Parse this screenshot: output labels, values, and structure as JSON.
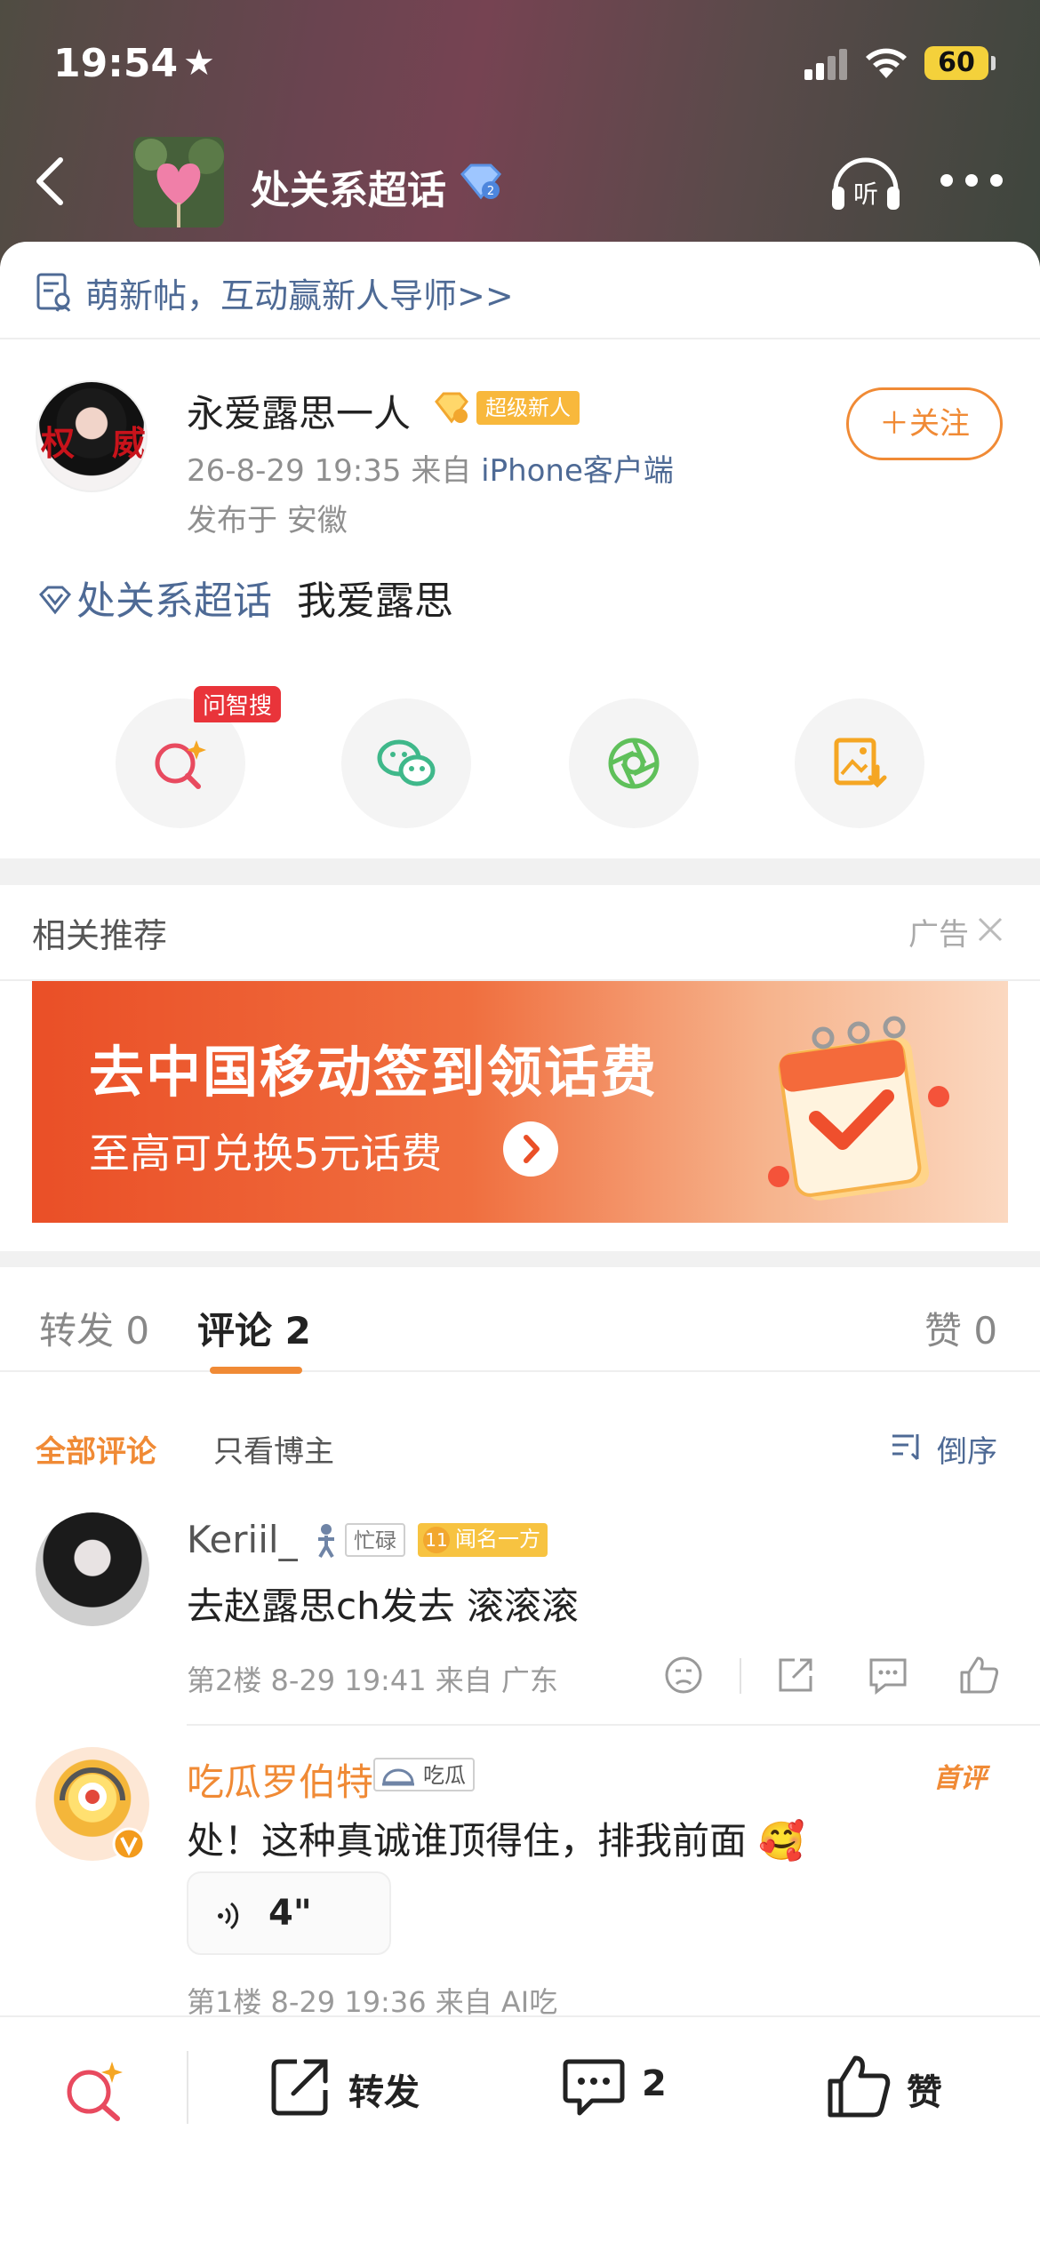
{
  "status_bar": {
    "time": "19:54",
    "battery": "60"
  },
  "nav": {
    "title": "处关系超话"
  },
  "newbie_bar": {
    "text": "萌新帖，互动赢新人导师>>"
  },
  "post": {
    "author": "永爱露思一人",
    "author_tag": "超级新人",
    "follow_label": "＋关注",
    "date": "26-8-29 19:35",
    "from_label": "来自",
    "source": "iPhone客户端",
    "location": "发布于 安徽",
    "topic": "处关系超话",
    "content": "我爱露思",
    "avatar_text_left": "权",
    "avatar_text_right": "威"
  },
  "actions": {
    "ask_tag": "问智搜"
  },
  "recommend": {
    "title": "相关推荐",
    "ad_label": "广告",
    "ad_title": "去中国移动签到领话费",
    "ad_subtitle": "至高可兑换5元话费"
  },
  "tabs": {
    "repost_label": "转发",
    "repost_count": "0",
    "comment_label": "评论",
    "comment_count": "2",
    "like_label": "赞",
    "like_count": "0"
  },
  "filters": {
    "all": "全部评论",
    "blogger_only": "只看博主",
    "sort": "倒序"
  },
  "comments": [
    {
      "name": "Keriil_",
      "tag1": "忙碌",
      "tag2": "闻名一方",
      "text": "去赵露思ch发去 滚滚滚",
      "meta": "第2楼 8-29 19:41 来自 广东"
    },
    {
      "name": "吃瓜罗伯特",
      "tag1": "吃瓜",
      "first_label": "首评",
      "text": "处！这种真诚谁顶得住，排我前面 🥰",
      "voice_duration": "4\"",
      "meta": "第1楼 8-29 19:36 来自 AI吃"
    }
  ],
  "bottom_bar": {
    "repost": "转发",
    "comments": "2",
    "like": "赞"
  },
  "colors": {
    "accent": "#f08a35",
    "link": "#4e6a95",
    "ad_red": "#ea4f27"
  }
}
